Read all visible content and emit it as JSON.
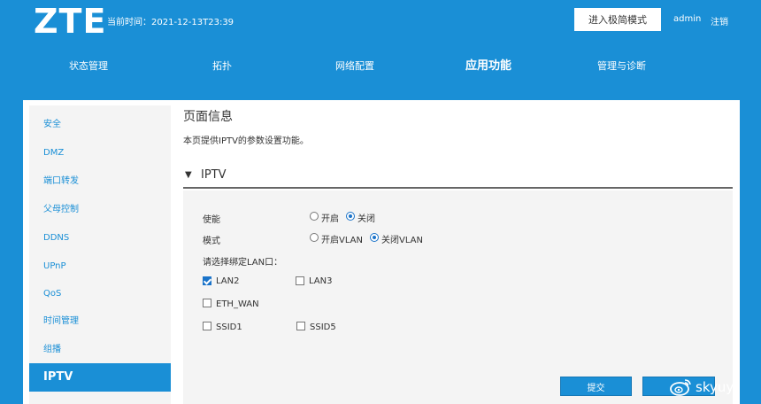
{
  "header": {
    "logo": "ZTE",
    "time_label": "当前时间：2021-12-13T23:39",
    "simple_mode_button": "进入极简模式",
    "user": "admin",
    "logout": "注销"
  },
  "nav": {
    "items": [
      {
        "label": "状态管理"
      },
      {
        "label": "拓扑"
      },
      {
        "label": "网络配置"
      },
      {
        "label": "应用功能",
        "active": true
      },
      {
        "label": "管理与诊断"
      }
    ]
  },
  "sidebar": {
    "items": [
      {
        "label": "安全"
      },
      {
        "label": "DMZ"
      },
      {
        "label": "端口转发"
      },
      {
        "label": "父母控制"
      },
      {
        "label": "DDNS"
      },
      {
        "label": "UPnP"
      },
      {
        "label": "QoS"
      },
      {
        "label": "时间管理"
      },
      {
        "label": "组播"
      },
      {
        "label": "IPTV",
        "active": true
      }
    ]
  },
  "main": {
    "title": "页面信息",
    "description": "本页提供IPTV的参数设置功能。",
    "section_title": "IPTV",
    "enable": {
      "label": "使能",
      "options": [
        {
          "label": "开启",
          "checked": false
        },
        {
          "label": "关闭",
          "checked": true
        }
      ]
    },
    "mode": {
      "label": "模式",
      "options": [
        {
          "label": "开启VLAN",
          "checked": false
        },
        {
          "label": "关闭VLAN",
          "checked": true
        }
      ]
    },
    "lan_prompt": "请选择绑定LAN口：",
    "ports": [
      {
        "label": "LAN2",
        "checked": true
      },
      {
        "label": "LAN3",
        "checked": false
      },
      {
        "label": "ETH_WAN",
        "checked": false
      },
      {
        "label": "SSID1",
        "checked": false
      },
      {
        "label": "SSID5",
        "checked": false
      }
    ],
    "submit_button": "提交",
    "cancel_button": ""
  },
  "watermark": {
    "text": "skyuy"
  },
  "colors": {
    "brand_blue": "#1a8fd6",
    "panel_bg": "#ffffff",
    "section_bg": "#f4f4f4",
    "control_blue": "#1a73c9"
  }
}
